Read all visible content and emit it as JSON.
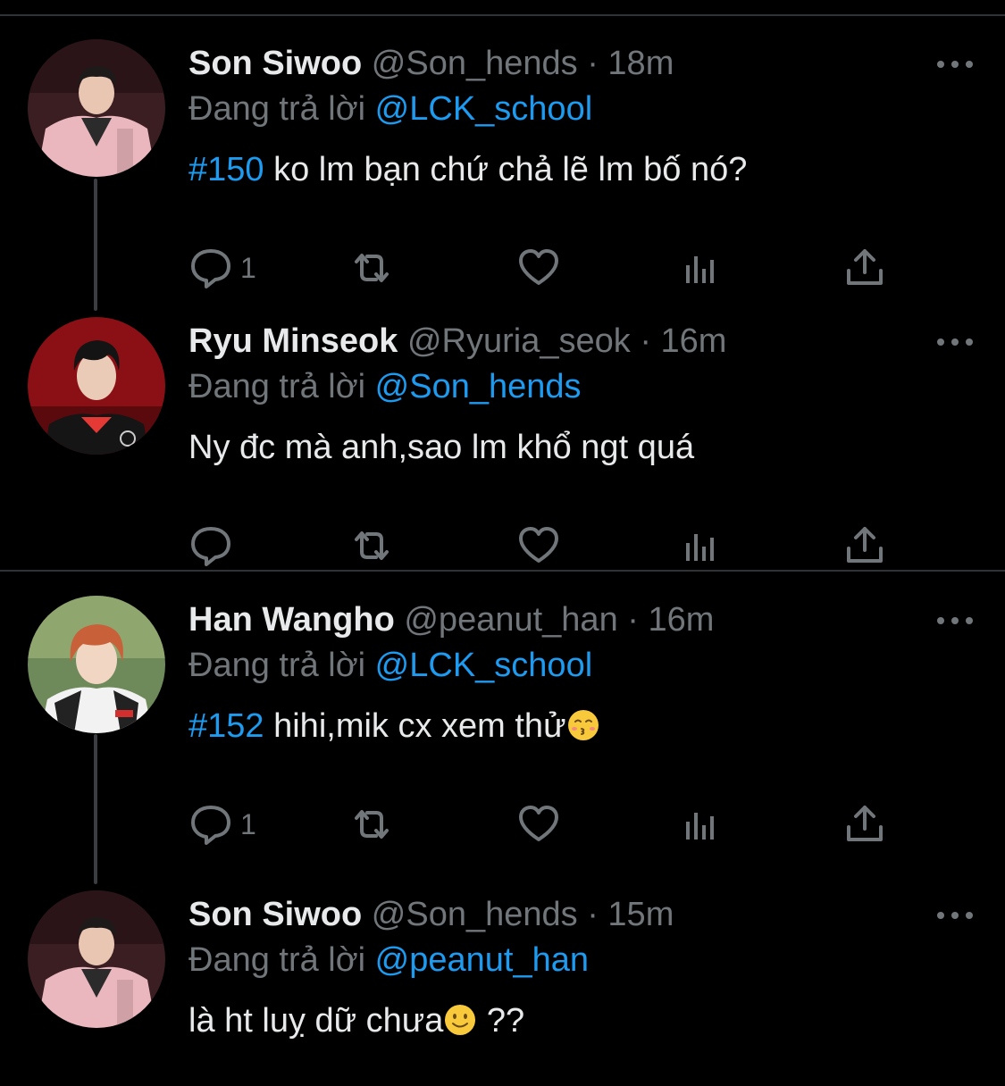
{
  "colors": {
    "background": "#000000",
    "divider": "#2f3336",
    "primary_text": "#e7e9ea",
    "secondary_text": "#71767b",
    "accent": "#1d9bf0"
  },
  "tweets": [
    {
      "name": "Son Siwoo",
      "handle": "@Son_hends",
      "separator": "·",
      "time": "18m",
      "reply_prefix": "Đang trả lời",
      "reply_to": "@LCK_school",
      "hashtag": "#150",
      "text": " ko lm bạn chứ chả lẽ lm bố nó?",
      "emoji": "",
      "trailing": "",
      "reply_count": "1",
      "avatar_icon": "avatar-son-siwoo"
    },
    {
      "name": "Ryu Minseok",
      "handle": "@Ryuria_seok",
      "separator": "·",
      "time": "16m",
      "reply_prefix": "Đang trả lời",
      "reply_to": "@Son_hends",
      "hashtag": "",
      "text": "Ny đc mà anh,sao lm khổ ngt quá",
      "emoji": "",
      "trailing": "",
      "reply_count": "",
      "avatar_icon": "avatar-ryu-minseok"
    },
    {
      "name": "Han Wangho",
      "handle": "@peanut_han",
      "separator": "·",
      "time": "16m",
      "reply_prefix": "Đang trả lời",
      "reply_to": "@LCK_school",
      "hashtag": "#152",
      "text": " hihi,mik cx xem thử",
      "emoji": "kissing-face",
      "trailing": "",
      "reply_count": "1",
      "avatar_icon": "avatar-han-wangho"
    },
    {
      "name": "Son Siwoo",
      "handle": "@Son_hends",
      "separator": "·",
      "time": "15m",
      "reply_prefix": "Đang trả lời",
      "reply_to": "@peanut_han",
      "hashtag": "",
      "text": "là ht luỵ dữ chưa",
      "emoji": "slightly-smiling-face",
      "trailing": " ??",
      "reply_count": "",
      "avatar_icon": "avatar-son-siwoo"
    }
  ],
  "icons": {
    "reply": "reply-icon",
    "retweet": "retweet-icon",
    "like": "heart-icon",
    "analytics": "analytics-icon",
    "share": "share-icon",
    "more": "more-icon"
  }
}
